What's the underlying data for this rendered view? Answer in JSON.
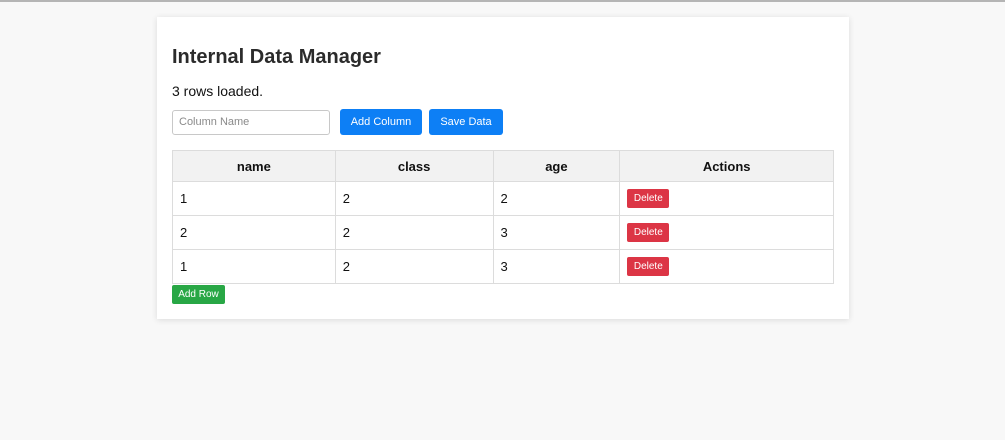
{
  "page": {
    "title": "Internal Data Manager",
    "status": "3 rows loaded."
  },
  "toolbar": {
    "column_input": {
      "placeholder": "Column Name",
      "value": ""
    },
    "add_column_label": "Add Column",
    "save_label": "Save Data"
  },
  "table": {
    "headers": [
      "name",
      "class",
      "age",
      "Actions"
    ],
    "rows": [
      [
        "1",
        "2",
        "2"
      ],
      [
        "2",
        "2",
        "3"
      ],
      [
        "1",
        "2",
        "3"
      ]
    ],
    "delete_label": "Delete"
  },
  "add_row_label": "Add Row",
  "colors": {
    "primary": "#0d7ff5",
    "danger": "#dc3545",
    "success": "#28a745",
    "background": "#f8f8f8"
  }
}
